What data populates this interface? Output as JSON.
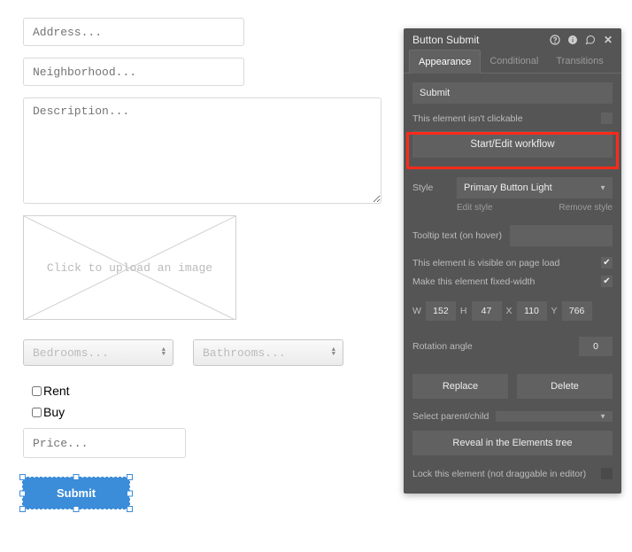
{
  "form": {
    "address_ph": "Address...",
    "neighborhood_ph": "Neighborhood...",
    "description_ph": "Description...",
    "image_label": "Click to upload an image",
    "bedrooms_ph": "Bedrooms...",
    "bathrooms_ph": "Bathrooms...",
    "rent_label": "Rent",
    "buy_label": "Buy",
    "price_ph": "Price...",
    "submit_label": "Submit"
  },
  "panel": {
    "title": "Button Submit",
    "tabs": {
      "appearance": "Appearance",
      "conditional": "Conditional",
      "transitions": "Transitions"
    },
    "name_value": "Submit",
    "not_clickable": "This element isn't clickable",
    "workflow_btn": "Start/Edit workflow",
    "style_label": "Style",
    "style_value": "Primary Button Light",
    "edit_style": "Edit style",
    "remove_style": "Remove style",
    "tooltip_label": "Tooltip text (on hover)",
    "visible_label": "This element is visible on page load",
    "fixed_label": "Make this element fixed-width",
    "dims": {
      "w_l": "W",
      "w": "152",
      "h_l": "H",
      "h": "47",
      "x_l": "X",
      "x": "110",
      "y_l": "Y",
      "y": "766"
    },
    "rotation_label": "Rotation angle",
    "rotation_value": "0",
    "replace": "Replace",
    "delete": "Delete",
    "select_parent": "Select parent/child",
    "reveal": "Reveal in the Elements tree",
    "lock": "Lock this element (not draggable in editor)"
  }
}
